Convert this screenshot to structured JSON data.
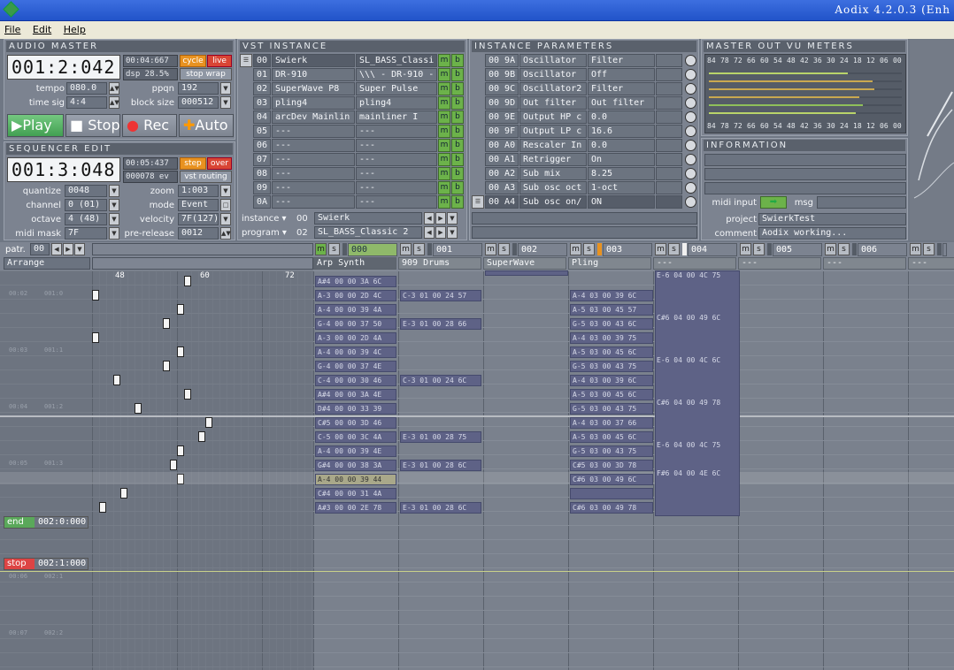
{
  "window": {
    "title": "Aodix 4.2.0.3 (Enh"
  },
  "menu": [
    {
      "label": "File"
    },
    {
      "label": "Edit"
    },
    {
      "label": "Help"
    }
  ],
  "audio_master": {
    "title": "AUDIO MASTER",
    "clock": "001:2:042",
    "time": "00:04:667",
    "dsp": "dsp 28.5%",
    "cycle": "cycle",
    "live": "live",
    "stop_wrap": "stop wrap",
    "tempo_label": "tempo",
    "tempo": "080.0",
    "ppqn_label": "ppqn",
    "ppqn": "192",
    "timesig_label": "time sig",
    "timesig": "4:4",
    "blocksize_label": "block size",
    "blocksize": "000512",
    "play": "Play",
    "stop": "Stop",
    "rec": "Rec",
    "auto": "Auto"
  },
  "sequencer_edit": {
    "title": "SEQUENCER EDIT",
    "clock": "001:3:048",
    "time": "00:05:437",
    "events": "000078 ev",
    "step": "step",
    "over": "over",
    "vst_routing": "vst routing",
    "quantize_label": "quantize",
    "quantize": "0048",
    "zoom_label": "zoom",
    "zoom": "1:003",
    "channel_label": "channel",
    "channel": "0 (01)",
    "mode_label": "mode",
    "mode": "Event",
    "octave_label": "octave",
    "octave": "4 (48)",
    "velocity_label": "velocity",
    "velocity": "7F(127)",
    "midimask_label": "midi mask",
    "midimask": "7F",
    "prerelease_label": "pre-release",
    "prerelease": "0012"
  },
  "vst_instance": {
    "title": "VST INSTANCE",
    "rows": [
      {
        "num": "00",
        "name": "Swierk",
        "prog": "SL_BASS_Classi"
      },
      {
        "num": "01",
        "name": "DR-910",
        "prog": "\\\\\\ - DR-910 -"
      },
      {
        "num": "02",
        "name": "SuperWave P8",
        "prog": "Super Pulse"
      },
      {
        "num": "03",
        "name": "pling4",
        "prog": "pling4"
      },
      {
        "num": "04",
        "name": "arcDev Mainlin",
        "prog": "mainliner I"
      },
      {
        "num": "05",
        "name": "---",
        "prog": "---"
      },
      {
        "num": "06",
        "name": "---",
        "prog": "---"
      },
      {
        "num": "07",
        "name": "---",
        "prog": "---"
      },
      {
        "num": "08",
        "name": "---",
        "prog": "---"
      },
      {
        "num": "09",
        "name": "---",
        "prog": "---"
      },
      {
        "num": "0A",
        "name": "---",
        "prog": "---"
      }
    ],
    "instance_label": "instance",
    "instance_num": "00",
    "instance_name": "Swierk",
    "program_label": "program",
    "program_num": "02",
    "program_name": "SL_BASS_Classic 2"
  },
  "instance_parameters": {
    "title": "INSTANCE PARAMETERS",
    "rows": [
      {
        "num": "00 9A",
        "name": "Oscillator",
        "value": "Filter"
      },
      {
        "num": "00 9B",
        "name": "Oscillator",
        "value": "Off"
      },
      {
        "num": "00 9C",
        "name": "Oscillator2",
        "value": "Filter"
      },
      {
        "num": "00 9D",
        "name": "Out filter",
        "value": "Out filter"
      },
      {
        "num": "00 9E",
        "name": "Output HP c",
        "value": "0.0"
      },
      {
        "num": "00 9F",
        "name": "Output LP c",
        "value": "16.6"
      },
      {
        "num": "00 A0",
        "name": "Rescaler In",
        "value": "0.0"
      },
      {
        "num": "00 A1",
        "name": "Retrigger",
        "value": "On"
      },
      {
        "num": "00 A2",
        "name": "Sub mix",
        "value": "8.25"
      },
      {
        "num": "00 A3",
        "name": "Sub osc oct",
        "value": "1-oct"
      },
      {
        "num": "00 A4",
        "name": "Sub osc on/",
        "value": "ON"
      }
    ]
  },
  "vu_meters": {
    "title": "MASTER OUT VU METERS",
    "scale": [
      "84",
      "78",
      "72",
      "66",
      "60",
      "54",
      "48",
      "42",
      "36",
      "30",
      "24",
      "18",
      "12",
      "06",
      "00"
    ],
    "levels": [
      0.72,
      0.85,
      0.86,
      0.78,
      0.8,
      0.76
    ]
  },
  "information": {
    "title": "INFORMATION",
    "midi_input_label": "midi input",
    "msg_label": "msg",
    "project_label": "project",
    "project": "SwierkTest",
    "comment_label": "comment",
    "comment": "Aodix working..."
  },
  "sequencer": {
    "patr_label": "patr.",
    "patr_value": "00",
    "arrange_label": "Arrange",
    "ruler": [
      "48",
      "60",
      "72"
    ],
    "end_label": "end",
    "end_time": "002:0:000",
    "stop_label": "stop",
    "stop_time": "002:1:000",
    "time_labels": [
      {
        "a": "00:02",
        "b": "001:0"
      },
      {
        "a": "00:03",
        "b": "001:1"
      },
      {
        "a": "00:04",
        "b": "001:2"
      },
      {
        "a": "00:05",
        "b": "001:3"
      },
      {
        "a": "00:06",
        "b": "002:1"
      },
      {
        "a": "00:07",
        "b": "002:2"
      }
    ],
    "tracks": [
      {
        "num": "000",
        "name": "Arp Synth"
      },
      {
        "num": "001",
        "name": "909 Drums"
      },
      {
        "num": "002",
        "name": "SuperWave"
      },
      {
        "num": "003",
        "name": "Pling"
      },
      {
        "num": "004",
        "name": "---"
      },
      {
        "num": "005",
        "name": "---"
      },
      {
        "num": "006",
        "name": "---"
      },
      {
        "num": "",
        "name": "---"
      }
    ],
    "track0_events": [
      "A#4 00 00 3A 6C",
      "A-3 00 00 2D 4C",
      "A-4 00 00 39 4A",
      "G-4 00 00 37 50",
      "A-3 00 00 2D 4A",
      "A-4 00 00 39 4C",
      "G-4 00 00 37 4E",
      "C-4 00 00 30 46",
      "A#4 00 00 3A 4E",
      "D#4 00 00 33 39",
      "C#5 00 00 3D 46",
      "C-5 00 00 3C 4A",
      "A-4 00 00 39 4E",
      "G#4 00 00 38 3A",
      "A-4 00 00 39 44",
      "C#4 00 00 31 4A",
      "A#3 00 00 2E 78"
    ],
    "track1_events": [
      {
        "row": 1,
        "text": "C-3 01 00 24 57"
      },
      {
        "row": 3,
        "text": "E-3 01 00 28 66"
      },
      {
        "row": 7,
        "text": "C-3 01 00 24 6C"
      },
      {
        "row": 11,
        "text": "E-3 01 00 28 75"
      },
      {
        "row": 13,
        "text": "E-3 01 00 28 6C"
      },
      {
        "row": 16,
        "text": "E-3 01 00 28 6C"
      }
    ],
    "track3_events": [
      "A-4 03 00 39 6C",
      "A-5 03 00 45 57",
      "G-5 03 00 43 6C",
      "A-4 03 00 39 75",
      "A-5 03 00 45 6C",
      "G-5 03 00 43 75",
      "A-4 03 00 39 6C",
      "A-5 03 00 45 6C",
      "G-5 03 00 43 75",
      "A-4 03 00 37 66",
      "A-5 03 00 45 6C",
      "G-5 03 00 43 75",
      "C#5 03 00 3D 78",
      "C#6 03 00 49 6C",
      "",
      "C#6 03 00 49 78"
    ],
    "track4_events": [
      {
        "row": 0,
        "text": "E-6 04 00 4C 75"
      },
      {
        "row": 3,
        "text": "C#6 04 00 49 6C"
      },
      {
        "row": 6,
        "text": "E-6 04 00 4C 6C"
      },
      {
        "row": 9,
        "text": "C#6 04 00 49 78"
      },
      {
        "row": 12,
        "text": "E-6 04 00 4C 75"
      },
      {
        "row": 14,
        "text": "F#6 04 00 4E 6C"
      }
    ]
  }
}
